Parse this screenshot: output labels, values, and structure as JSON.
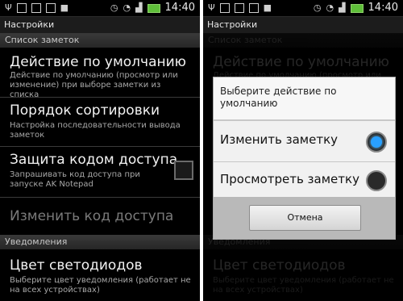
{
  "status": {
    "time": "14:40"
  },
  "app": {
    "title": "Настройки"
  },
  "sections": {
    "notes_list": "Список заметок",
    "notifications": "Уведомления"
  },
  "prefs": {
    "default_action": {
      "title": "Действие по умолчанию",
      "summary": "Действие по умолчанию (просмотр или изменение) при выборе заметки из списка"
    },
    "sort_order": {
      "title": "Порядок сортировки",
      "summary": "Настройка последовательности вывода заметок"
    },
    "passcode": {
      "title": "Защита кодом доступа",
      "summary": "Запрашивать код доступа при запуске AK Notepad",
      "checked": false
    },
    "change_passcode": {
      "title": "Изменить код доступа"
    },
    "led_color": {
      "title": "Цвет светодиодов",
      "summary": "Выберите цвет уведомления (работает не на всех устройствах)"
    }
  },
  "dialog": {
    "title": "Выберите действие по умолчанию",
    "options": [
      {
        "label": "Изменить заметку",
        "selected": true
      },
      {
        "label": "Просмотреть заметку",
        "selected": false
      }
    ],
    "cancel_label": "Отмена"
  },
  "colors": {
    "radio_selected": "#29a0ff",
    "background": "#000000"
  }
}
